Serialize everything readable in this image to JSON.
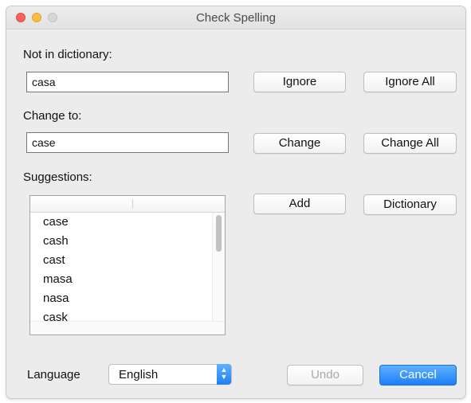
{
  "window": {
    "title": "Check Spelling"
  },
  "labels": {
    "not_in_dictionary": "Not in dictionary:",
    "change_to": "Change to:",
    "suggestions": "Suggestions:",
    "language": "Language"
  },
  "fields": {
    "misspelled_word": "casa",
    "replacement": "case"
  },
  "buttons": {
    "ignore": "Ignore",
    "ignore_all": "Ignore All",
    "change": "Change",
    "change_all": "Change All",
    "add": "Add",
    "dictionary": "Dictionary",
    "undo": "Undo",
    "cancel": "Cancel"
  },
  "suggestions": [
    "case",
    "cash",
    "cast",
    "masa",
    "nasa",
    "cask"
  ],
  "language": {
    "selected": "English"
  },
  "colors": {
    "accent": "#1d7ff6",
    "close": "#fc605c",
    "minimize": "#fdbc40",
    "zoom_disabled": "#d6d6d6"
  },
  "icons": [
    "close-icon",
    "minimize-icon",
    "zoom-icon",
    "popup-arrows-icon"
  ]
}
